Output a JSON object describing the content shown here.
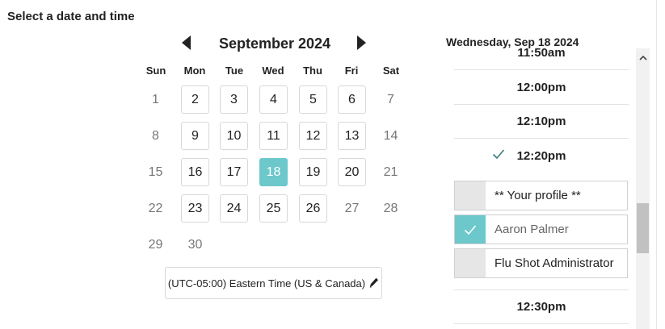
{
  "page": {
    "section_title": "Select a date and time"
  },
  "calendar": {
    "month_label": "September 2024",
    "weekdays": [
      "Sun",
      "Mon",
      "Tue",
      "Wed",
      "Thu",
      "Fri",
      "Sat"
    ],
    "weeks": [
      [
        {
          "d": "1",
          "s": "na"
        },
        {
          "d": "2",
          "s": "avail"
        },
        {
          "d": "3",
          "s": "avail"
        },
        {
          "d": "4",
          "s": "avail"
        },
        {
          "d": "5",
          "s": "avail"
        },
        {
          "d": "6",
          "s": "avail"
        },
        {
          "d": "7",
          "s": "na"
        }
      ],
      [
        {
          "d": "8",
          "s": "na"
        },
        {
          "d": "9",
          "s": "avail"
        },
        {
          "d": "10",
          "s": "avail"
        },
        {
          "d": "11",
          "s": "avail"
        },
        {
          "d": "12",
          "s": "avail"
        },
        {
          "d": "13",
          "s": "avail"
        },
        {
          "d": "14",
          "s": "na"
        }
      ],
      [
        {
          "d": "15",
          "s": "na"
        },
        {
          "d": "16",
          "s": "avail"
        },
        {
          "d": "17",
          "s": "avail"
        },
        {
          "d": "18",
          "s": "selected"
        },
        {
          "d": "19",
          "s": "avail"
        },
        {
          "d": "20",
          "s": "avail"
        },
        {
          "d": "21",
          "s": "na"
        }
      ],
      [
        {
          "d": "22",
          "s": "na"
        },
        {
          "d": "23",
          "s": "avail"
        },
        {
          "d": "24",
          "s": "avail"
        },
        {
          "d": "25",
          "s": "avail"
        },
        {
          "d": "26",
          "s": "avail"
        },
        {
          "d": "27",
          "s": "na"
        },
        {
          "d": "28",
          "s": "na"
        }
      ],
      [
        {
          "d": "29",
          "s": "na"
        },
        {
          "d": "30",
          "s": "na"
        }
      ]
    ],
    "timezone_label": "(UTC-05:00) Eastern Time (US & Canada)",
    "icons": {
      "prev": "triangle-left-icon",
      "next": "triangle-right-icon",
      "edit": "pencil-icon"
    }
  },
  "time_panel": {
    "date_heading": "Wednesday, Sep 18 2024",
    "slots": [
      {
        "time": "11:50am",
        "checked": false
      },
      {
        "time": "12:00pm",
        "checked": false
      },
      {
        "time": "12:10pm",
        "checked": false
      },
      {
        "time": "12:20pm",
        "checked": true
      },
      {
        "time": "12:30pm",
        "checked": false
      }
    ],
    "providers": [
      {
        "name": "** Your profile **",
        "selected": false
      },
      {
        "name": "Aaron Palmer",
        "selected": true
      },
      {
        "name": "Flu Shot Administrator",
        "selected": false
      }
    ],
    "accent_color": "#6cc8cb"
  }
}
